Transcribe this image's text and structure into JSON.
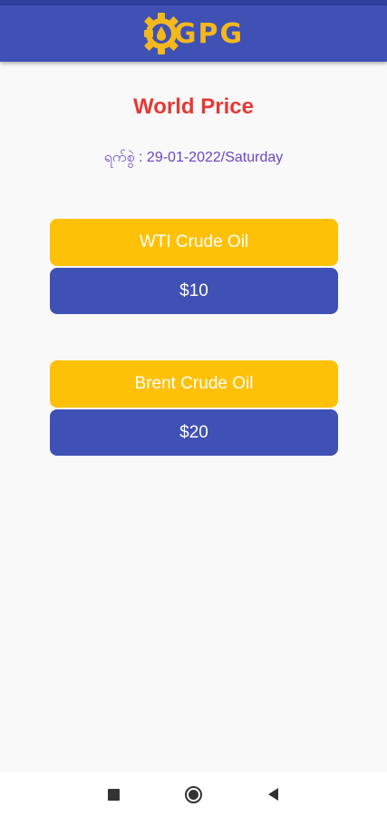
{
  "app_bar": {
    "logo_text": "GPG",
    "logo_icon": "gear-oil-drop-icon",
    "background": "#3f51b5",
    "logo_color": "#f3b81c"
  },
  "main": {
    "title": "World Price",
    "date_label": "ရက်စွဲ : 29-01-2022/Saturday",
    "prices": [
      {
        "name": "WTI Crude Oil",
        "value": "$10"
      },
      {
        "name": "Brent Crude Oil",
        "value": "$20"
      }
    ]
  },
  "colors": {
    "title": "#e53935",
    "date": "#6a45c9",
    "label_box": "#ffc107",
    "value_box": "#3f51b5"
  },
  "nav": {
    "buttons": [
      "recent-apps-icon",
      "home-icon",
      "back-icon"
    ]
  }
}
